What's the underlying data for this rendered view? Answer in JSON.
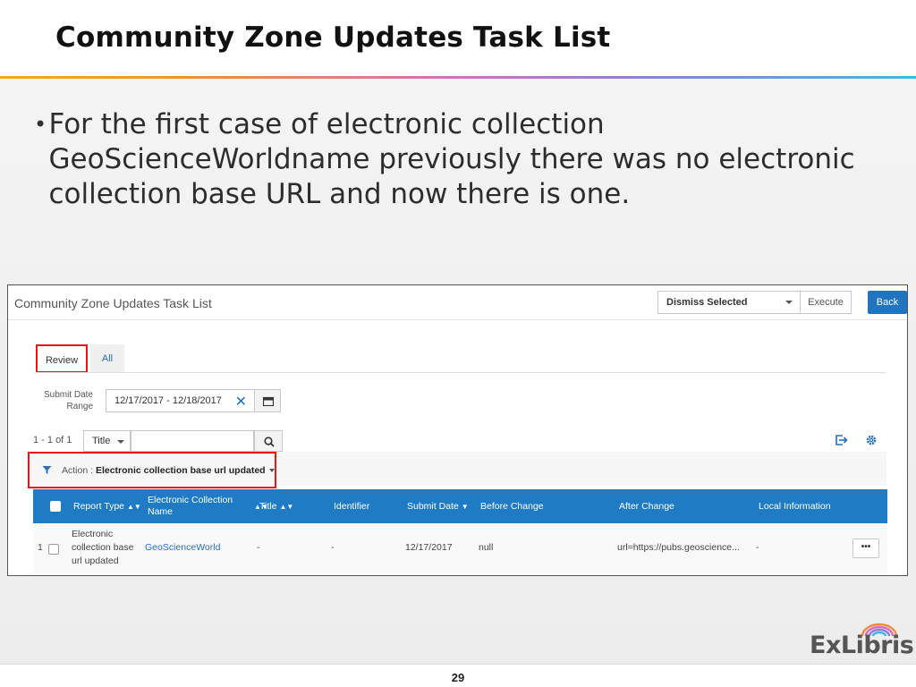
{
  "slide": {
    "title": "Community Zone Updates Task List",
    "bullet": "For the first case of electronic collection GeoScienceWorldname previously there was no electronic collection base URL and now there is one.",
    "page_number": "29",
    "logo_text": "ExLibris"
  },
  "app": {
    "title": "Community Zone Updates Task List",
    "dismiss_select": "Dismiss Selected",
    "execute_label": "Execute",
    "back_label": "Back",
    "tabs": [
      {
        "label": "Review",
        "active": true
      },
      {
        "label": "All",
        "active": false
      }
    ],
    "submit_date_label": "Submit Date Range",
    "date_range": "12/17/2017 - 12/18/2017",
    "count": "1 - 1 of 1",
    "search_field": "Title",
    "search_value": "",
    "filter_label": "Action :",
    "filter_value": "Electronic collection base url updated",
    "columns": [
      "Report Type",
      "Electronic Collection Name",
      "Title",
      "Identifier",
      "Submit Date",
      "Before Change",
      "After Change",
      "Local Information"
    ],
    "rows": [
      {
        "index": "1",
        "report_type": "Electronic collection base url updated",
        "collection_name": "GeoScienceWorld",
        "title": "-",
        "identifier": "-",
        "submit_date": "12/17/2017",
        "before_change": "null",
        "after_change": "url=https://pubs.geoscience...",
        "local_information": "-",
        "actions_label": "•••"
      }
    ],
    "icons": {
      "clear": "close-icon",
      "calendar": "calendar-icon",
      "search": "search-icon",
      "export": "export-icon",
      "settings": "gear-icon",
      "filter": "filter-icon"
    },
    "colors": {
      "accent": "#1e7bc4",
      "highlight_box": "#e8141a",
      "back_button": "#2074c0"
    }
  }
}
